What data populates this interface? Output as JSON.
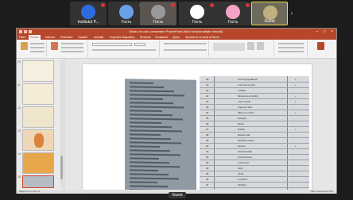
{
  "video_strip": {
    "participants": [
      {
        "name": "Institutul P...",
        "avatar_icon": "person-icon",
        "avatar_color": "#2d6cdf"
      },
      {
        "name": "Гость",
        "avatar_icon": "cat-icon",
        "avatar_color": "#6aa0e6"
      },
      {
        "name": "Гость",
        "avatar_icon": "webcam-person",
        "avatar_color": "#999999"
      },
      {
        "name": "Гость",
        "avatar_icon": "cat-icon",
        "avatar_color": "#ffffff"
      },
      {
        "name": "Гость",
        "avatar_icon": "bunny-icon",
        "avatar_color": "#f5a3c7"
      },
      {
        "name": "Guest",
        "avatar_icon": "webcam-person",
        "avatar_color": "#c0b080",
        "highlighted": true
      }
    ]
  },
  "app": {
    "title": "Studiu de caz: prezentare PowerPoint (Mod funcționalitate redusă)",
    "tabs": [
      "Fișier",
      "Pornire",
      "Inserare",
      "Proiectare",
      "Tranziții",
      "Animații",
      "Expunere diapozitive",
      "Revizuire",
      "Vizualizare",
      "Ajutor",
      "Spuneți-mi ce doriți să faceți"
    ],
    "active_tab_index": 1,
    "status_left": "Diapozitiv 11 din 14",
    "status_right": "Note   Comentarii   78%"
  },
  "thumbnails": [
    {
      "num": "10"
    },
    {
      "num": "11"
    },
    {
      "num": "12"
    },
    {
      "num": "13"
    },
    {
      "num": "14"
    },
    {
      "num": "15"
    }
  ],
  "slide": {
    "right_table_rows": [
      {
        "num": "18",
        "text": "Sarcini gospodărești",
        "val": "+"
      },
      {
        "num": "19",
        "text": "Locul de trai rural",
        "val": "+"
      },
      {
        "num": "20",
        "text": "Cetățeni",
        "val": ""
      },
      {
        "num": "21",
        "text": "Mostenirea de tradiții",
        "val": "+"
      },
      {
        "num": "22",
        "text": "Legea satului",
        "val": "+"
      },
      {
        "num": "23",
        "text": "Lupta de valori",
        "val": ""
      },
      {
        "num": "24",
        "text": "Munca în comun",
        "val": "+"
      },
      {
        "num": "25",
        "text": "Ocupații",
        "val": ""
      },
      {
        "num": "26",
        "text": "Dialog",
        "val": ""
      },
      {
        "num": "27",
        "text": "Familia",
        "val": "+"
      },
      {
        "num": "28",
        "text": "Resurse utile",
        "val": ""
      },
      {
        "num": "29",
        "text": "Resursele satului",
        "val": ""
      },
      {
        "num": "30",
        "text": "Resurse",
        "val": "+"
      },
      {
        "num": "31",
        "text": "Teritoriul sfânt",
        "val": ""
      },
      {
        "num": "32",
        "text": "Teritoriul rural",
        "val": ""
      },
      {
        "num": "33",
        "text": "Locul natal",
        "val": ""
      },
      {
        "num": "34",
        "text": "Satul",
        "val": ""
      },
      {
        "num": "35",
        "text": "Vecini",
        "val": ""
      },
      {
        "num": "36",
        "text": "Localitate",
        "val": ""
      },
      {
        "num": "37",
        "text": "Sărbători",
        "val": ""
      },
      {
        "num": "38",
        "text": "Spațiu",
        "val": ""
      }
    ]
  },
  "bottom_label": "Guest"
}
